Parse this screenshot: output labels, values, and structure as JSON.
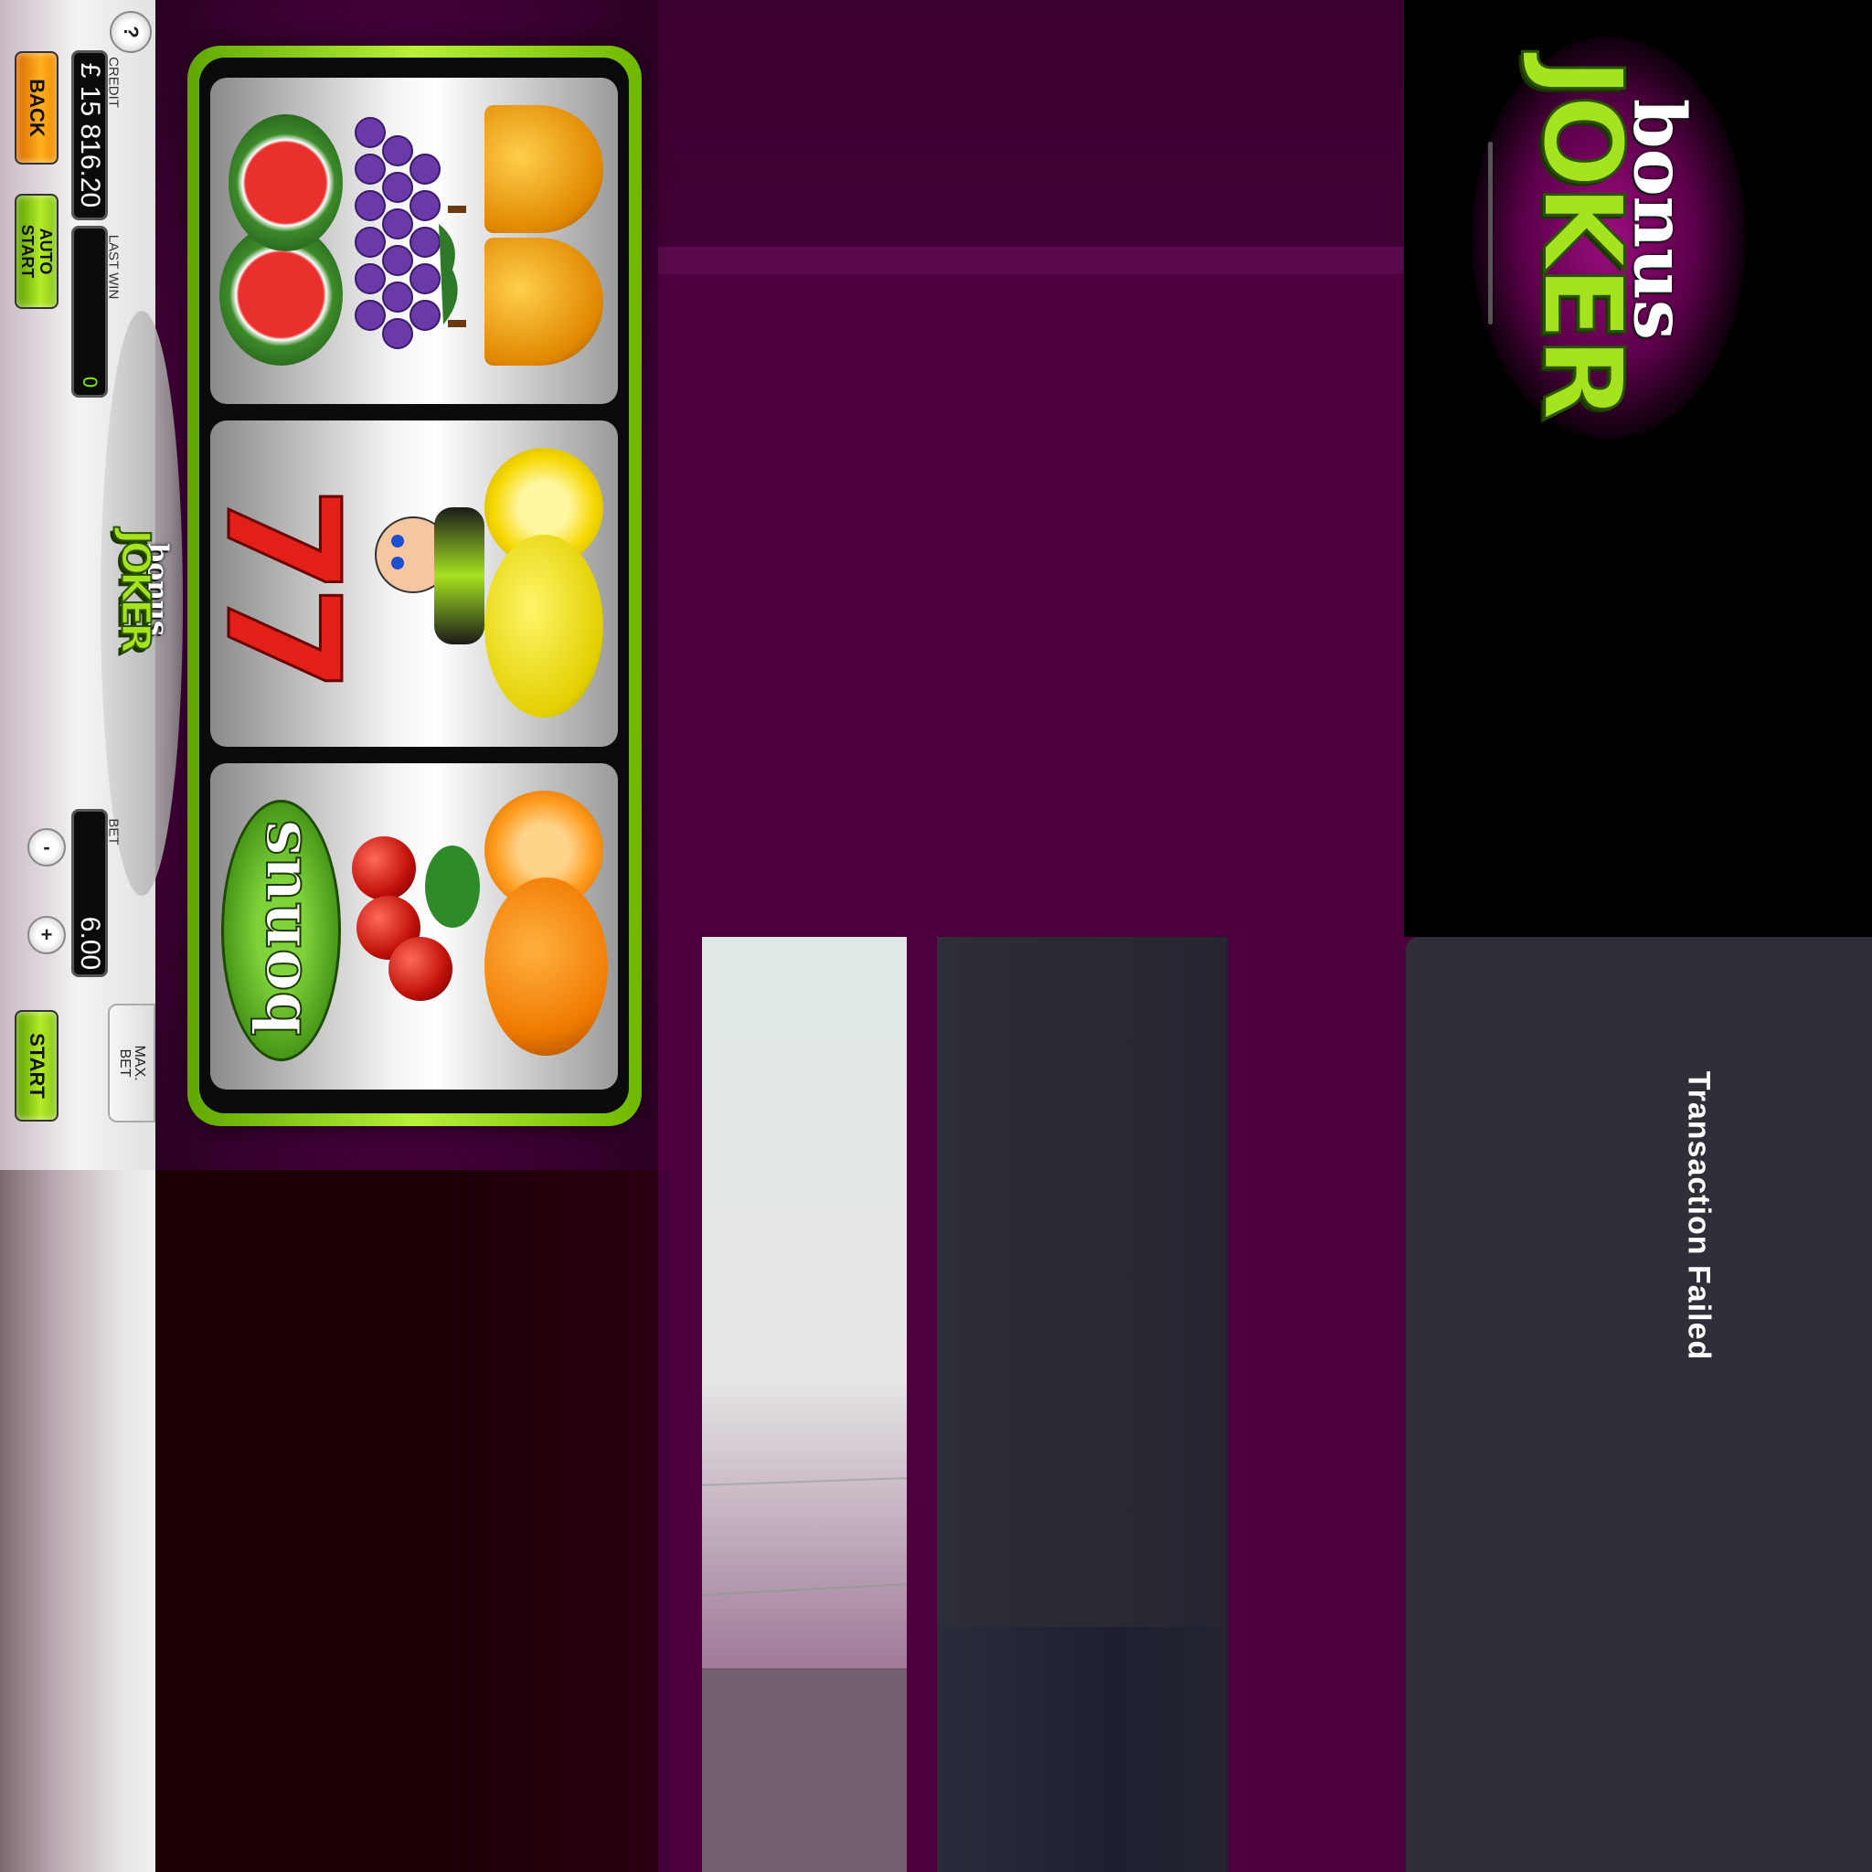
{
  "controls": {
    "help_label": "?",
    "back_label": "BACK",
    "auto_start_label": "AUTO\nSTART",
    "start_label": "START",
    "max_bet_label": "MAX.\nBET",
    "minus_label": "-",
    "plus_label": "+"
  },
  "credit": {
    "label": "CREDIT",
    "value": "£ 15 816.20"
  },
  "last_win": {
    "label": "LAST WIN",
    "value": "0"
  },
  "bet": {
    "label": "BET",
    "value": "6.00"
  },
  "logo": {
    "bonus": "bonus",
    "joker": "JOKER"
  },
  "reels": [
    [
      "watermelon-icon",
      "grapes-icon",
      "bell-icon"
    ],
    [
      "seven-icon",
      "joker-icon",
      "lemon-icon"
    ],
    [
      "bonus-icon",
      "cherry-icon",
      "orange-icon"
    ]
  ],
  "bonus_symbol_text": "bonus",
  "seven_symbol_text": "77",
  "dialog": {
    "message": "Transaction Failed"
  },
  "colors": {
    "accent_green": "#a5e21f",
    "accent_orange": "#ffb020",
    "background_purple": "#4e0040",
    "dialog_bg": "#302e38"
  }
}
